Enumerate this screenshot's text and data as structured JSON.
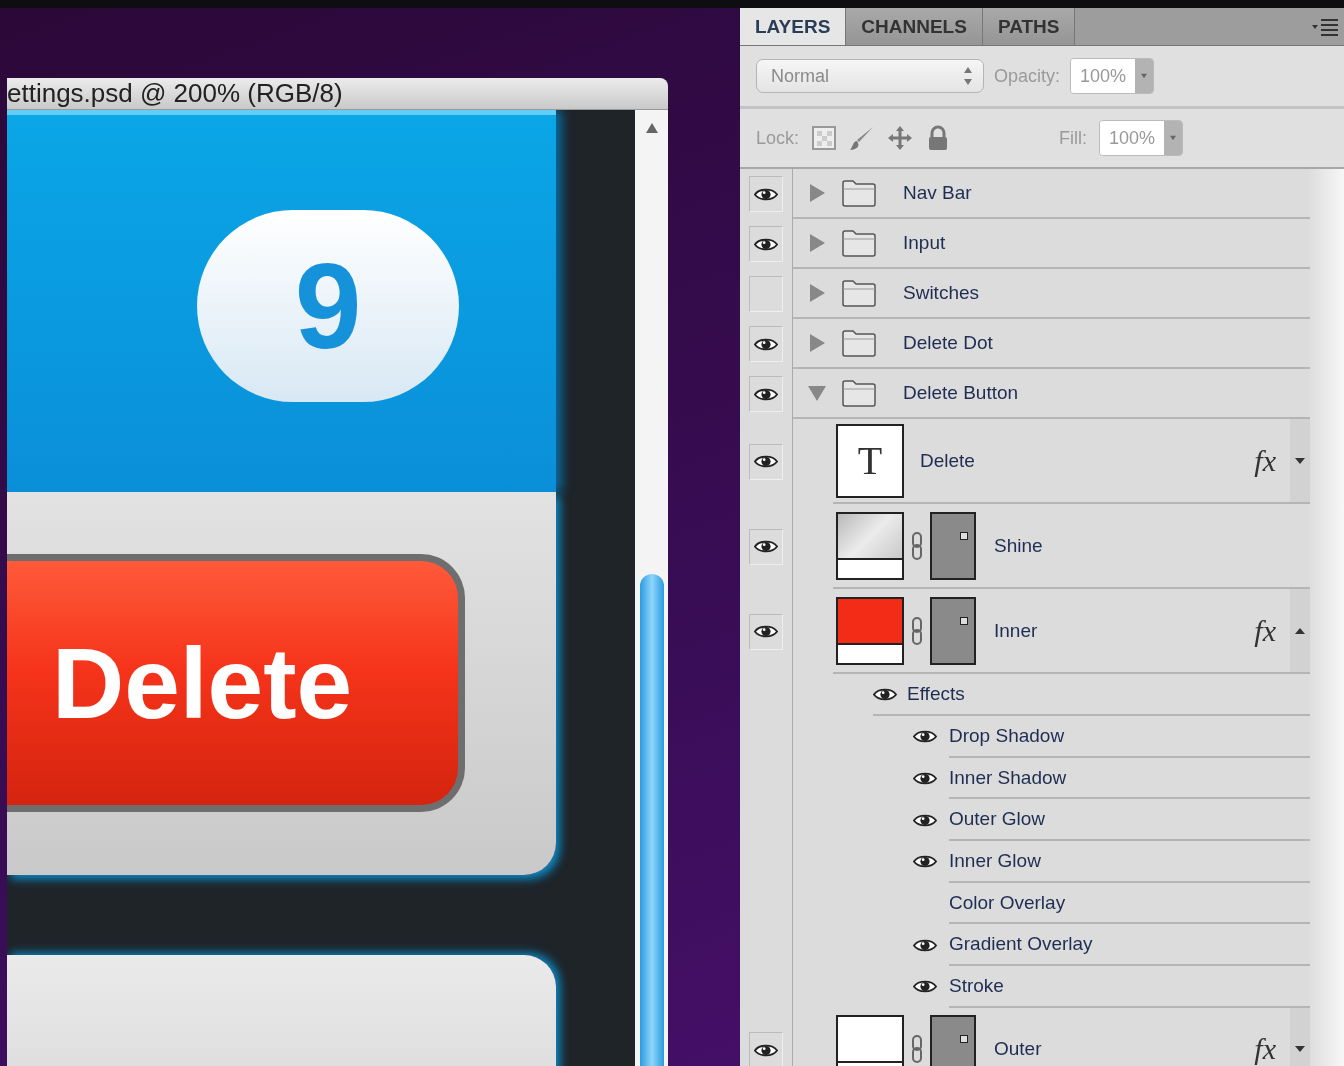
{
  "document": {
    "title": "ettings.psd @ 200% (RGB/8)",
    "badge": "9",
    "button": "Delete"
  },
  "panel": {
    "tabs": [
      {
        "label": "LAYERS",
        "selected": true
      },
      {
        "label": "CHANNELS",
        "selected": false
      },
      {
        "label": "PATHS",
        "selected": false
      }
    ],
    "blend_mode": "Normal",
    "opacity_label": "Opacity:",
    "opacity": "100%",
    "lock_label": "Lock:",
    "fill_label": "Fill:",
    "fill": "100%",
    "layers": [
      {
        "kind": "group",
        "name": "Nav Bar",
        "visible": true,
        "expanded": false
      },
      {
        "kind": "group",
        "name": "Input",
        "visible": true,
        "expanded": false
      },
      {
        "kind": "group",
        "name": "Switches",
        "visible": false,
        "expanded": false
      },
      {
        "kind": "group",
        "name": "Delete Dot",
        "visible": true,
        "expanded": false
      },
      {
        "kind": "group",
        "name": "Delete Button",
        "visible": true,
        "expanded": true,
        "children": [
          {
            "kind": "text",
            "name": "Delete",
            "visible": true,
            "thumb": "T",
            "fx": "fx",
            "effects_expanded": false
          },
          {
            "kind": "gradient",
            "name": "Shine",
            "visible": true
          },
          {
            "kind": "shape",
            "name": "Inner",
            "visible": true,
            "color": "#f22c16",
            "fx": "fx",
            "effects_expanded": true,
            "effects": {
              "name": "Effects",
              "visible": true,
              "items": [
                {
                  "name": "Drop Shadow",
                  "visible": true
                },
                {
                  "name": "Inner Shadow",
                  "visible": true
                },
                {
                  "name": "Outer Glow",
                  "visible": true
                },
                {
                  "name": "Inner Glow",
                  "visible": true
                },
                {
                  "name": "Color Overlay",
                  "visible": false
                },
                {
                  "name": "Gradient Overlay",
                  "visible": true
                },
                {
                  "name": "Stroke",
                  "visible": true
                }
              ]
            }
          },
          {
            "kind": "shape",
            "name": "Outer",
            "visible": true,
            "color": "#ffffff",
            "fx": "fx",
            "effects_expanded": false
          }
        ]
      }
    ]
  }
}
